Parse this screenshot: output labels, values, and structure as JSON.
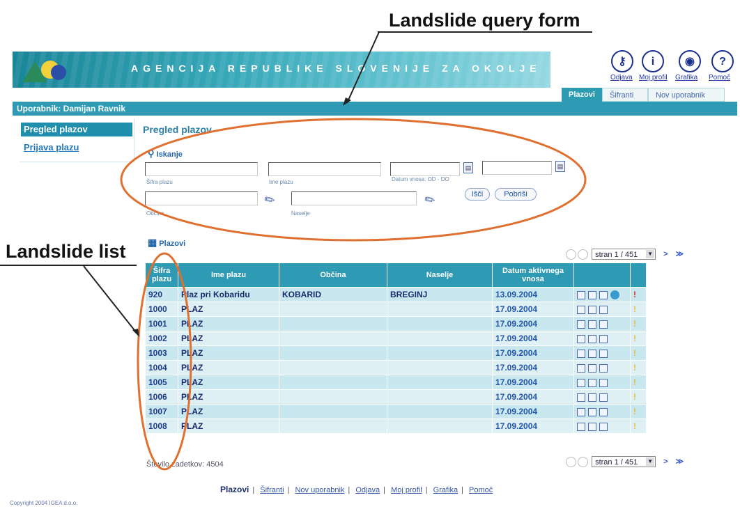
{
  "annotations": {
    "query_form": "Landslide query form",
    "list": "Landslide list"
  },
  "banner": {
    "agency": "AGENCIJA REPUBLIKE SLOVENIJE ZA OKOLJE"
  },
  "top_links": [
    {
      "label": "Odjava",
      "icon": "key-icon"
    },
    {
      "label": "Moj profil",
      "icon": "info-icon"
    },
    {
      "label": "Grafika",
      "icon": "globe-icon"
    },
    {
      "label": "Pomoč",
      "icon": "help-icon"
    }
  ],
  "tabs": [
    "Plazovi",
    "Šifranti",
    "Nov uporabnik"
  ],
  "user_bar": "Uporabnik: Damijan Ravnik",
  "nav": {
    "pregled": "Pregled plazov",
    "prijava": "Prijava plazu"
  },
  "page_title": "Pregled plazov",
  "search": {
    "label": "Iskanje",
    "sifra_label": "Šifra plazu",
    "ime_label": "Ime plazu",
    "datum_label": "Datum vnosa: OD - DO",
    "obcina_label": "Občina",
    "naselje_label": "Naselje",
    "search_button": "Išči",
    "clear_button": "Pobriši"
  },
  "results": {
    "label": "Plazovi",
    "page_select": "stran 1 / 451",
    "count": "Število zadetkov: 4504",
    "columns": [
      "Šifra plazu",
      "Ime plazu",
      "Občina",
      "Naselje",
      "Datum aktivnega vnosa"
    ],
    "rows": [
      {
        "sifra": "920",
        "ime": "Plaz pri Kobaridu",
        "obcina": "KOBARID",
        "naselje": "BREGINJ",
        "datum": "13.09.2004"
      },
      {
        "sifra": "1000",
        "ime": "PLAZ",
        "obcina": "",
        "naselje": "",
        "datum": "17.09.2004"
      },
      {
        "sifra": "1001",
        "ime": "PLAZ",
        "obcina": "",
        "naselje": "",
        "datum": "17.09.2004"
      },
      {
        "sifra": "1002",
        "ime": "PLAZ",
        "obcina": "",
        "naselje": "",
        "datum": "17.09.2004"
      },
      {
        "sifra": "1003",
        "ime": "PLAZ",
        "obcina": "",
        "naselje": "",
        "datum": "17.09.2004"
      },
      {
        "sifra": "1004",
        "ime": "PLAZ",
        "obcina": "",
        "naselje": "",
        "datum": "17.09.2004"
      },
      {
        "sifra": "1005",
        "ime": "PLAZ",
        "obcina": "",
        "naselje": "",
        "datum": "17.09.2004"
      },
      {
        "sifra": "1006",
        "ime": "PLAZ",
        "obcina": "",
        "naselje": "",
        "datum": "17.09.2004"
      },
      {
        "sifra": "1007",
        "ime": "PLAZ",
        "obcina": "",
        "naselje": "",
        "datum": "17.09.2004"
      },
      {
        "sifra": "1008",
        "ime": "PLAZ",
        "obcina": "",
        "naselje": "",
        "datum": "17.09.2004"
      }
    ]
  },
  "footer": {
    "links": [
      "Plazovi",
      "Šifranti",
      "Nov uporabnik",
      "Odjava",
      "Moj profil",
      "Grafika",
      "Pomoč"
    ],
    "copyright": "Copyright 2004 IGEA d.o.o."
  },
  "colors": {
    "accent": "#2f9ab3",
    "annotation_ellipse": "#e07030"
  }
}
